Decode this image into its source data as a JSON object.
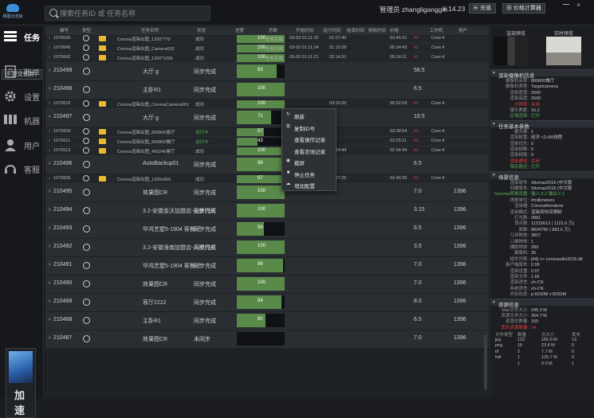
{
  "app": {
    "logo_text": "晴图云渲染"
  },
  "search": {
    "placeholder": "搜索任务ID 或 任务名称"
  },
  "header": {
    "user_prefix": "管理员",
    "username": "zhangliganggm",
    "balance": "¥ 14.23",
    "recharge_label": "充值",
    "calculator_label": "价格计算器"
  },
  "sidebar": {
    "items": [
      {
        "label": "任务",
        "icon": "tasks-icon"
      },
      {
        "label": "账单",
        "icon": "bill-icon"
      },
      {
        "label": "设置",
        "icon": "gear-icon"
      },
      {
        "label": "机器",
        "icon": "server-icon"
      },
      {
        "label": "用户",
        "icon": "user-icon"
      },
      {
        "label": "客服",
        "icon": "headset-icon"
      }
    ],
    "submit_label": "提交任务",
    "accelerate_label_1": "加",
    "accelerate_label_2": "速"
  },
  "grid": {
    "headers": [
      "编号",
      "类型",
      "任务名称",
      "状态",
      "进度",
      "总数",
      "开始时间",
      "运行时间",
      "结束时间",
      "帧耗时间",
      "价格",
      "工作机",
      "用户"
    ],
    "rows": [
      {
        "kind": "sub",
        "id": "1070636",
        "name": "Corona渲染出图_1200*770",
        "status": "成功",
        "progress": "100",
        "pct": 1.0,
        "total": "任务完成",
        "start": "03-03 01:11:25",
        "run": "01:07:40",
        "end": "",
        "frame": "03:46:31",
        "price": "#1",
        "worker": "Core:4",
        "user": ""
      },
      {
        "kind": "sub",
        "id": "1070640",
        "name": "Corona渲染出图_Camera002",
        "status": "成功",
        "progress": "100",
        "pct": 1.0,
        "total": "任务完成",
        "start": "03-03 01:11:24",
        "run": "01:10:28",
        "end": "",
        "frame": "05:24:43",
        "price": "#1",
        "worker": "Core:4",
        "user": ""
      },
      {
        "kind": "sub",
        "id": "1070642",
        "name": "Corona渲染出图_1200*1200",
        "status": "成功",
        "progress": "100",
        "pct": 1.0,
        "total": "任务完成",
        "start": "03-03 01:11:21",
        "run": "02:14:31",
        "end": "",
        "frame": "05:24:11",
        "price": "#1",
        "worker": "Core:4",
        "user": ""
      },
      {
        "kind": "main",
        "id": "210499",
        "name": "大厅 g",
        "status": "同步完成",
        "progress": "83",
        "pct": 0.83,
        "frame": "",
        "price": "58.5",
        "user": ""
      },
      {
        "kind": "main",
        "id": "210498",
        "name": "主卧R1",
        "status": "同步完成",
        "progress": "100",
        "pct": 1.0,
        "frame": "",
        "price": "6.5",
        "user": ""
      },
      {
        "kind": "sub",
        "id": "1070616",
        "name": "Corona渲染出图_CoronaCamera001",
        "status": "成功",
        "progress": "100",
        "pct": 1.0,
        "total": "",
        "start": "",
        "run": "03:26:35",
        "end": "",
        "frame": "05:52:09",
        "price": "#1",
        "worker": "Core:4",
        "user": ""
      },
      {
        "kind": "main",
        "id": "210497",
        "name": "大厅 g",
        "status": "同步完成",
        "progress": "71",
        "pct": 0.71,
        "frame": "",
        "price": "19.5",
        "user": ""
      },
      {
        "kind": "sub",
        "id": "1070609",
        "name": "Corona渲染出图_800800客厅",
        "status": "运行中",
        "progress": "57",
        "pct": 0.57,
        "total": "",
        "start": "",
        "run": "",
        "end": "",
        "frame": "03:38:54",
        "price": "#1",
        "worker": "Core:4",
        "user": ""
      },
      {
        "kind": "sub",
        "id": "1070611",
        "name": "Corona渲染出图_800800餐厅",
        "status": "运行中",
        "progress": "43",
        "pct": 0.43,
        "total": "",
        "start": "",
        "run": "",
        "end": "",
        "frame": "03:25:11",
        "price": "#1",
        "worker": "Core:4",
        "user": ""
      },
      {
        "kind": "sub",
        "id": "1070613",
        "name": "Corona渲染出图_400240客厅",
        "status": "成功",
        "progress": "100",
        "pct": 1.0,
        "total": "",
        "start": "",
        "run": "03:44:44",
        "end": "",
        "frame": "02:34:44",
        "price": "#1",
        "worker": "Core:4",
        "user": ""
      },
      {
        "kind": "main",
        "id": "210496",
        "name": "AutoBackup01",
        "status": "同步完成",
        "progress": "98",
        "pct": 0.98,
        "frame": "",
        "price": "6.5",
        "user": ""
      },
      {
        "kind": "sub",
        "id": "1070606",
        "name": "Corona渲染出图_1200x900",
        "status": "成功",
        "progress": "97",
        "pct": 0.97,
        "total": "",
        "start": "03-03 01:11:06",
        "run": "02:47:25",
        "end": "",
        "frame": "02:46:35",
        "price": "#1",
        "worker": "Core:4",
        "user": ""
      },
      {
        "kind": "main",
        "id": "210495",
        "name": "效果图CR",
        "status": "同步完成",
        "progress": "100",
        "pct": 1.0,
        "frame": "",
        "price": "7.0",
        "user": "1396"
      },
      {
        "kind": "main",
        "id": "210494",
        "name": "3.2-安徽金沃加盟店-全景门头",
        "status": "同步完成",
        "progress": "100",
        "pct": 1.0,
        "frame": "",
        "price": "3.15",
        "user": "1396"
      },
      {
        "kind": "main",
        "id": "210493",
        "name": "华鸿艺墅5-1904 客餐厅",
        "status": "同步完成",
        "progress": "56",
        "pct": 0.56,
        "frame": "",
        "price": "6.5",
        "user": "1396"
      },
      {
        "kind": "main",
        "id": "210492",
        "name": "3.2-安徽淮南加盟店-人视门头",
        "status": "同步完成",
        "progress": "100",
        "pct": 1.0,
        "frame": "",
        "price": "3.5",
        "user": "1396"
      },
      {
        "kind": "main",
        "id": "210491",
        "name": "华鸿艺墅5-1904 客餐厅",
        "status": "同步完成",
        "progress": "96",
        "pct": 0.96,
        "frame": "",
        "price": "7.0",
        "user": "1396"
      },
      {
        "kind": "main",
        "id": "210490",
        "name": "效果图CR",
        "status": "同步完成",
        "progress": "100",
        "pct": 1.0,
        "frame": "",
        "price": "7.0",
        "user": "1396"
      },
      {
        "kind": "main",
        "id": "210489",
        "name": "客厅2222",
        "status": "同步完成",
        "progress": "94",
        "pct": 0.94,
        "frame": "",
        "price": "8.0",
        "user": "1396"
      },
      {
        "kind": "main",
        "id": "210488",
        "name": "主卧R1",
        "status": "同步完成",
        "progress": "60",
        "pct": 0.6,
        "frame": "",
        "price": "6.5",
        "user": "1396"
      },
      {
        "kind": "main",
        "id": "210487",
        "name": "效果图CR",
        "status": "未同步",
        "progress": "",
        "pct": 0.0,
        "frame": "",
        "price": "7.0",
        "user": "1396"
      }
    ]
  },
  "context_menu": {
    "items": [
      {
        "label": "刷新",
        "icon": "refresh-icon",
        "glyph": "↻"
      },
      {
        "label": "复制ID号",
        "icon": "copy-icon",
        "glyph": "⧉"
      },
      {
        "label": "查看操作记录",
        "icon": "",
        "glyph": ""
      },
      {
        "label": "查看农场记录",
        "icon": "",
        "glyph": ""
      },
      {
        "label": "截屏",
        "icon": "eye-icon",
        "glyph": "◉"
      },
      {
        "label": "停止任务",
        "icon": "stop-icon",
        "glyph": "■"
      },
      {
        "label": "增加配置",
        "icon": "cloud-icon",
        "glyph": "☁"
      }
    ]
  },
  "right_panel": {
    "tabs": [
      "渲染预览",
      "实时预览"
    ],
    "sections": [
      {
        "title": "渲染摄像机信息",
        "rows": [
          {
            "k": "摄像机名称:",
            "v": "800800餐厅",
            "c": ""
          },
          {
            "k": "摄像机类型:",
            "v": "Targetcamera",
            "c": ""
          },
          {
            "k": "渲染宽度:",
            "v": "2500",
            "c": ""
          },
          {
            "k": "渲染高度:",
            "v": "2500",
            "c": ""
          },
          {
            "k": "分辨率:",
            "v": "关闭",
            "c": "red"
          },
          {
            "k": "镜头焦距:",
            "v": "16.2",
            "c": ""
          },
          {
            "k": "区域渲染:",
            "v": "打开",
            "c": "green"
          }
        ]
      },
      {
        "title": "任务基本参数",
        "rows": [
          {
            "k": "摄头数:",
            "v": "1",
            "c": ""
          },
          {
            "k": "渲染配置:",
            "v": "经济 <2+80线程",
            "c": ""
          },
          {
            "k": "渲染优先:",
            "v": "0",
            "c": ""
          },
          {
            "k": "渲染帧数:",
            "v": "0",
            "c": ""
          },
          {
            "k": "渲染帧尾:",
            "v": "0",
            "c": ""
          },
          {
            "k": "渲染通道:",
            "v": "关闭",
            "c": "red"
          },
          {
            "k": "保存路径:",
            "v": "打开",
            "c": "green"
          }
        ]
      },
      {
        "title": "场景信息",
        "rows": [
          {
            "k": "渲染软件:",
            "v": "3dsmax2016 (中文版",
            "c": ""
          },
          {
            "k": "创建版本:",
            "v": "3dsmax2016 (中文版",
            "c": ""
          },
          {
            "k": "Gamma转换设置:",
            "v": "输入:2.2 输出:2.2",
            "c": "green"
          },
          {
            "k": "场景单位:",
            "v": "#millimeters",
            "c": ""
          },
          {
            "k": "渲染器:",
            "v": "CoronaRenderer",
            "c": ""
          },
          {
            "k": "渲染模式:",
            "v": "渲染到时间限制",
            "c": ""
          },
          {
            "k": "灯光数:",
            "v": "3981",
            "c": ""
          },
          {
            "k": "顶点数:",
            "v": "11215613 ( 1121.6 万)",
            "c": ""
          },
          {
            "k": "面数:",
            "v": "8834795 ( 883.5 万)",
            "c": ""
          },
          {
            "k": "几何物体:",
            "v": "3807",
            "c": ""
          },
          {
            "k": "二维物体:",
            "v": "1",
            "c": ""
          },
          {
            "k": "辅助物体:",
            "v": "289",
            "c": ""
          },
          {
            "k": "摄像机:",
            "v": "35",
            "c": ""
          },
          {
            "k": "插件列表:",
            "v": "[44] <> coronautils2016.dlt",
            "c": ""
          },
          {
            "k": "客户端版本:",
            "v": "0.99",
            "c": ""
          },
          {
            "k": "渲染设置:",
            "v": "0.07",
            "c": ""
          },
          {
            "k": "渲染文件:",
            "v": "1.66",
            "c": ""
          },
          {
            "k": "渲染语言:",
            "v": "zh-CN",
            "c": ""
          },
          {
            "k": "系统语言:",
            "v": "zh-CN",
            "c": ""
          },
          {
            "k": "内存信息:",
            "v": "p:6030M v:8250M",
            "c": ""
          }
        ]
      },
      {
        "title": "资源信息",
        "rows": [
          {
            "k": "Max文件大小:",
            "v": "245.3 M",
            "c": ""
          },
          {
            "k": "资源文件大小:",
            "v": "354.7 M",
            "c": ""
          },
          {
            "k": "资源总数量:",
            "v": "155",
            "c": ""
          },
          {
            "k": "丢失资源数量:",
            "v": "14",
            "c": "red"
          }
        ]
      }
    ],
    "file_table": {
      "headers": [
        "文件类型",
        "数量",
        "总大小",
        "丢失"
      ],
      "rows": [
        [
          "jpg",
          "133",
          "186.6 M",
          "13"
        ],
        [
          "png",
          "18",
          "23.8 M",
          "0"
        ],
        [
          "tif",
          "2",
          "7.7 M",
          "0"
        ],
        [
          "hdr",
          "1",
          "135.7 M",
          "0"
        ],
        [
          "",
          "1",
          "0.0 M",
          "1"
        ]
      ]
    }
  },
  "colors": {
    "progress": "#5a8a4a",
    "accent": "#3a8fd8",
    "danger": "#e04040",
    "ok": "#5ab05a"
  }
}
